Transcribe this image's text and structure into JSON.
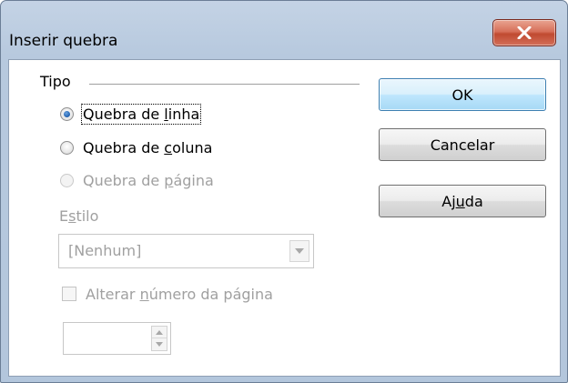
{
  "window": {
    "title": "Inserir quebra",
    "close_icon": "close-icon"
  },
  "type_group": {
    "label": "Tipo",
    "options": [
      {
        "before": "Quebra de ",
        "mnemonic": "l",
        "after": "inha",
        "checked": true,
        "enabled": true
      },
      {
        "before": "Quebra de ",
        "mnemonic": "c",
        "after": "oluna",
        "checked": false,
        "enabled": true
      },
      {
        "before": "Quebra de ",
        "mnemonic": "p",
        "after": "ágina",
        "checked": false,
        "enabled": false
      }
    ]
  },
  "style": {
    "label_before": "E",
    "label_mnemonic": "s",
    "label_after": "tilo",
    "selected": "[Nenhum]"
  },
  "change_page_number": {
    "before": "Alterar ",
    "mnemonic": "n",
    "after": "úmero da página",
    "checked": false,
    "enabled": false
  },
  "page_number_field": {
    "value": ""
  },
  "buttons": {
    "ok": "OK",
    "cancel": "Cancelar",
    "help_before": "Aj",
    "help_mnemonic": "u",
    "help_after": "da"
  },
  "colors": {
    "title_bar": "#b7c9de",
    "close_button": "#c8553d",
    "default_button_border": "#3c7fb1",
    "disabled_text": "#a0a0a0"
  }
}
